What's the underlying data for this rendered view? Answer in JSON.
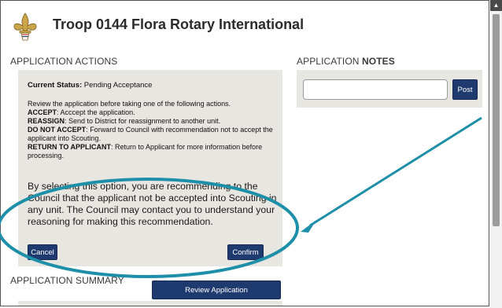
{
  "header": {
    "title": "Troop 0144 Flora Rotary International"
  },
  "actions": {
    "section_label": "APPLICATION ACTIONS",
    "status_label": "Current Status:",
    "status_value": "Pending Acceptance",
    "intro": "Review the application before taking one of the following actions.",
    "options": [
      {
        "term": "ACCEPT",
        "desc": "Acccept the application."
      },
      {
        "term": "REASSIGN",
        "desc": "Send to District for reassignment to another unit."
      },
      {
        "term": "DO NOT ACCEPT",
        "desc": "Forward to Council with recommendation not to accept the applicant into Scouting."
      },
      {
        "term": "RETURN TO APPLICANT",
        "desc": "Return to Applicant for more information before processing."
      }
    ],
    "confirm_message": "By selecting this option, you are recommending to the Council that the applicant not be accepted into Scouting in any unit. The Council may contact you to understand your reasoning for making this recommendation.",
    "cancel_label": "Cancel",
    "confirm_label": "Confirm"
  },
  "notes": {
    "label_prefix": "APPLICATION ",
    "label_bold": "NOTES",
    "input_value": "",
    "post_label": "Post"
  },
  "summary": {
    "section_label": "APPLICATION SUMMARY",
    "review_label": "Review Application"
  },
  "colors": {
    "button": "#1f3a6e",
    "panel": "#e8e6e1",
    "annotation": "#1e8fa8",
    "logo_gold": "#caa54a"
  },
  "icons": {
    "logo": "fleur-de-lis-icon",
    "scroll_up": "chevron-up-icon"
  }
}
